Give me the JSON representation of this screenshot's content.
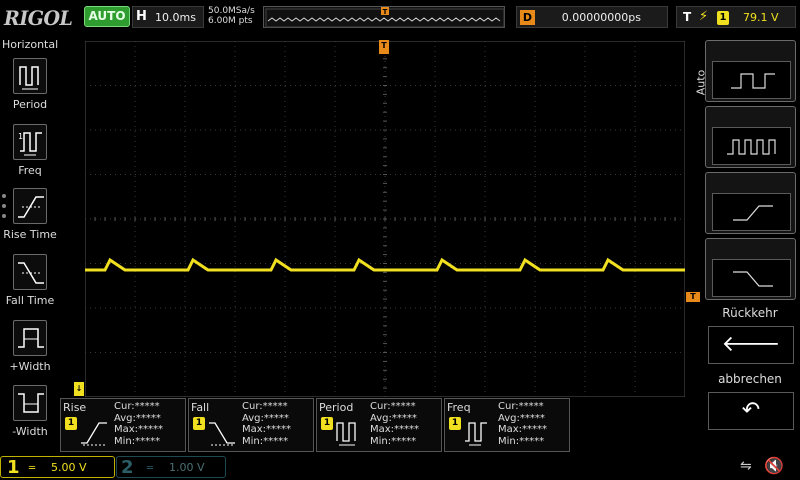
{
  "brand": "RIGOL",
  "top": {
    "run_mode": "AUTO",
    "timebase_label": "H",
    "timebase": "10.0ms",
    "sample_rate": "50.0MSa/s",
    "mem_depth": "6.00M pts",
    "delay_label": "D",
    "delay": "0.00000000ps",
    "trigger_label": "T",
    "trigger_channel": "1",
    "trigger_level": "79.1 V"
  },
  "left_menu": {
    "title": "Horizontal",
    "items": [
      {
        "label": "Period",
        "icon": "period-icon"
      },
      {
        "label": "Freq",
        "icon": "frequency-icon"
      },
      {
        "label": "Rise Time",
        "icon": "rise-time-icon"
      },
      {
        "label": "Fall Time",
        "icon": "fall-time-icon"
      },
      {
        "label": "+Width",
        "icon": "positive-width-icon"
      },
      {
        "label": "-Width",
        "icon": "negative-width-icon"
      }
    ]
  },
  "right_menu": {
    "title": "Auto",
    "keys": [
      {
        "icon": "single-cycle-icon"
      },
      {
        "icon": "multi-cycle-icon"
      },
      {
        "icon": "rising-edge-icon"
      },
      {
        "icon": "falling-edge-icon"
      }
    ],
    "back_label": "Rückkehr",
    "back_icon": "left-arrow-icon",
    "cancel_label": "abbrechen",
    "cancel_icon": "undo-icon"
  },
  "measurements": [
    {
      "name": "Rise",
      "channel": "1",
      "cur": "Cur:*****",
      "avg": "Avg:*****",
      "max": "Max:*****",
      "min": "Min:*****"
    },
    {
      "name": "Fall",
      "channel": "1",
      "cur": "Cur:*****",
      "avg": "Avg:*****",
      "max": "Max:*****",
      "min": "Min:*****"
    },
    {
      "name": "Period",
      "channel": "1",
      "cur": "Cur:*****",
      "avg": "Avg:*****",
      "max": "Max:*****",
      "min": "Min:*****"
    },
    {
      "name": "Freq",
      "channel": "1",
      "cur": "Cur:*****",
      "avg": "Avg:*****",
      "max": "Max:*****",
      "min": "Min:*****"
    }
  ],
  "channels": [
    {
      "number": "1",
      "scale": "5.00 V",
      "color": "#f0e020",
      "enabled": true
    },
    {
      "number": "2",
      "scale": "1.00 V",
      "color": "#2b8c96",
      "enabled": false
    }
  ],
  "colors": {
    "ch1": "#f0e020",
    "trigger": "#e88a1a",
    "grid": "#3a3a3a",
    "auto_button": "#2f9c2f"
  }
}
